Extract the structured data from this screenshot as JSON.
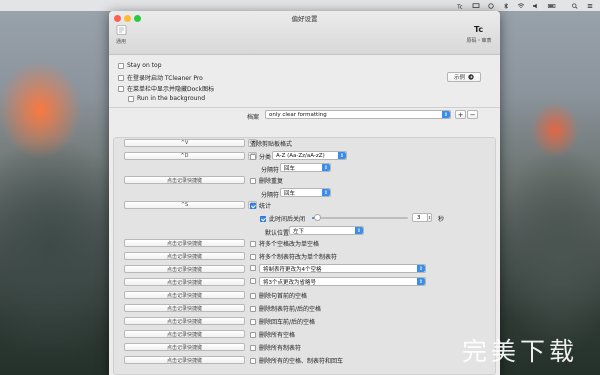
{
  "menubar": {
    "time_label": ""
  },
  "window": {
    "title": "偏好设置",
    "left_tool_label": "通用",
    "right_tool_label": "原码・审表"
  },
  "general": {
    "stay_on_top": "Stay on top",
    "launch_at_login": "在登录时启动 TCleaner Pro",
    "hide_dock": "在菜单栏中显示并隐藏Dock图标",
    "run_background": "Run in the background",
    "example_button": "示例"
  },
  "profile": {
    "label": "档案",
    "selected": "only clear formatting",
    "add": "+",
    "remove": "−"
  },
  "hotkeys": {
    "shift_v": "^V",
    "shift_d": "^D",
    "shift_s": "^S",
    "record_prompt": "点击记录快捷键",
    "clear_icon": "⌫"
  },
  "options": {
    "clear_format": "清除剪贴板格式",
    "sort": "分类",
    "sort_value": "A-Z (Aa-Zz/aA-zZ)",
    "separator_label": "分隔符",
    "separator_value": "回车",
    "dedupe": "删除重复",
    "separator2_value": "回车",
    "stats": "统计",
    "auto_close": "此时间后关闭",
    "auto_close_value": "3",
    "auto_close_unit": "秒",
    "auto_close_fraction": 0.03,
    "default_position": "默认位置",
    "position_value": "左下",
    "multi_space": "将多个空格改为单空格",
    "multi_tab": "将多个制表符改为单个制表符",
    "tab_to_space": "将制表符更改为4个空格",
    "dots": "将3个点更改为省略号",
    "trim_leading": "删除句首前的空格",
    "trim_tabs": "删除制表符前/后的空格",
    "trim_returns": "删除回车前/后的空格",
    "remove_spaces": "删除所有空格",
    "remove_tabs": "删除所有制表符",
    "remove_all": "删除所有的空格、制表符和回车"
  },
  "watermark": "完美下载",
  "colors": {
    "accent": "#3a8dea",
    "close": "#fc5f57",
    "minimize": "#fdbc2e",
    "zoom": "#29c941"
  }
}
